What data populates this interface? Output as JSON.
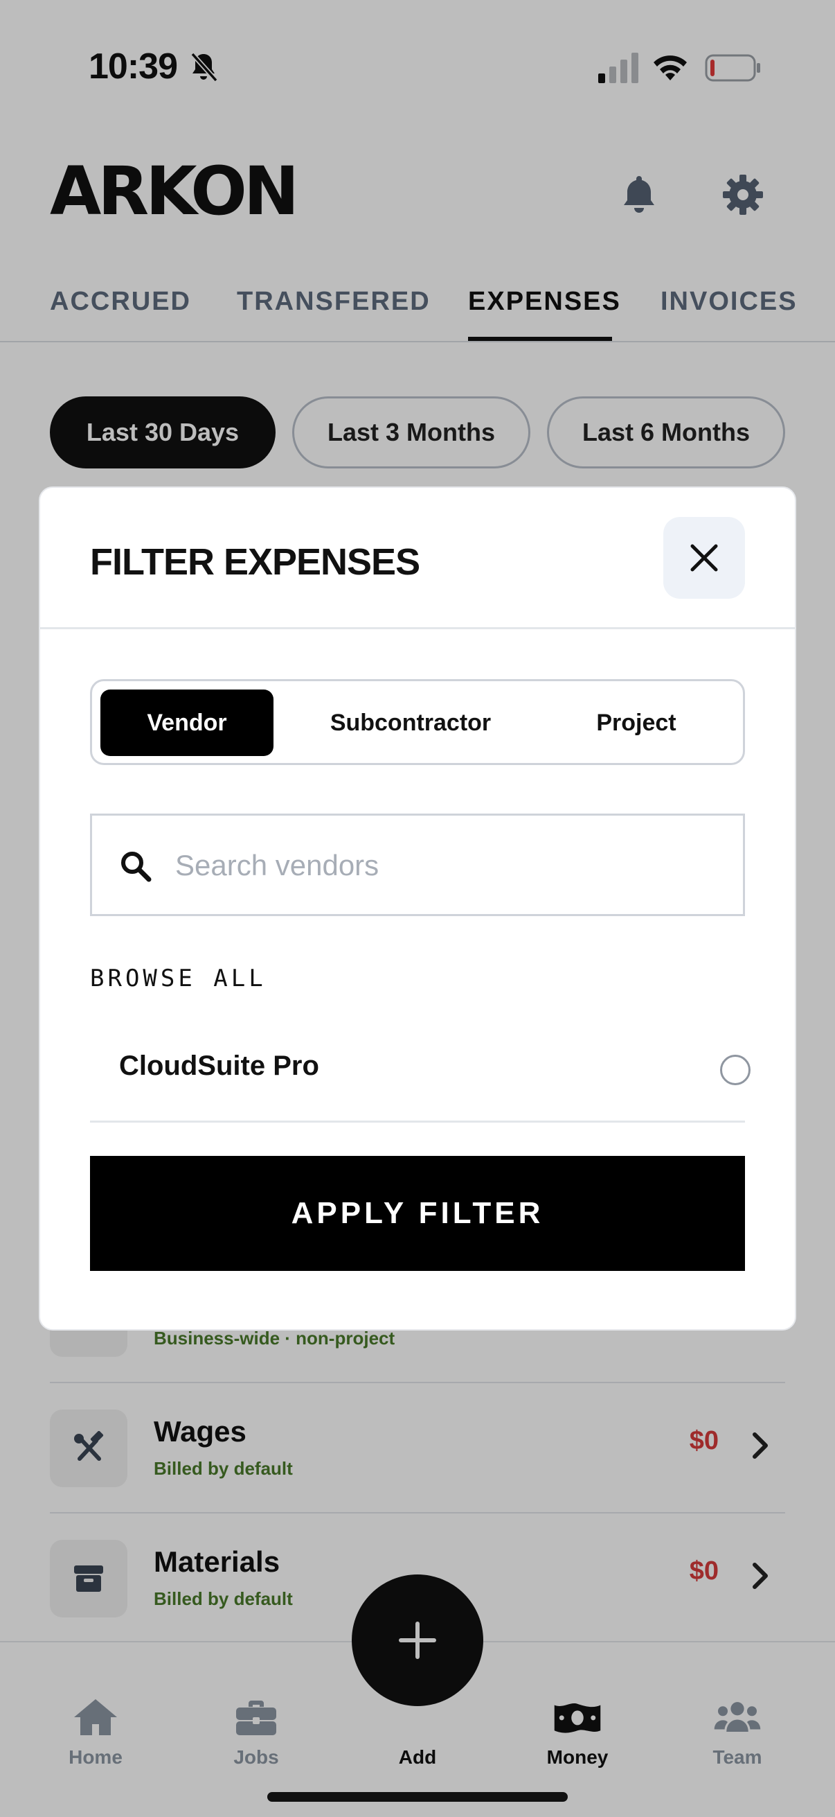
{
  "status_bar": {
    "time": "10:39"
  },
  "header": {
    "logo": "ARKON"
  },
  "tabs": [
    {
      "label": "ACCRUED"
    },
    {
      "label": "TRANSFERED"
    },
    {
      "label": "EXPENSES"
    },
    {
      "label": "INVOICES"
    }
  ],
  "ranges": [
    {
      "label": "Last 30 Days"
    },
    {
      "label": "Last 3 Months"
    },
    {
      "label": "Last 6 Months"
    }
  ],
  "expense_rows": [
    {
      "title": "",
      "subtitle": "Business-wide · non-project"
    },
    {
      "title": "Wages",
      "subtitle": "Billed by default",
      "amount": "$0"
    },
    {
      "title": "Materials",
      "subtitle": "Billed by default",
      "amount": "$0"
    }
  ],
  "modal": {
    "title": "FILTER EXPENSES",
    "segments": [
      {
        "label": "Vendor"
      },
      {
        "label": "Subcontractor"
      },
      {
        "label": "Project"
      }
    ],
    "search_placeholder": "Search vendors",
    "browse_label": "BROWSE ALL",
    "vendors": [
      {
        "name": "CloudSuite Pro"
      }
    ],
    "apply_label": "APPLY FILTER"
  },
  "nav": [
    {
      "label": "Home"
    },
    {
      "label": "Jobs"
    },
    {
      "label": "Add"
    },
    {
      "label": "Money"
    },
    {
      "label": "Team"
    }
  ],
  "colors": {
    "accent_dark": "#111111",
    "amount_red": "#d63a3a",
    "subtitle_green": "#4a7a2a",
    "muted_gray": "#5d6b7e"
  }
}
